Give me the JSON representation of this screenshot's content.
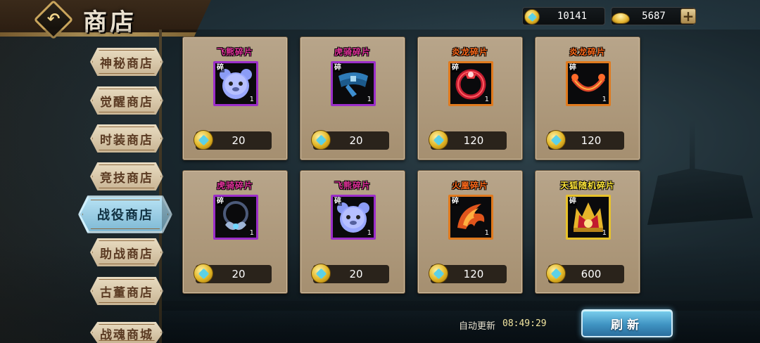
{
  "header": {
    "title": "商店",
    "back_icon": "back-arrow-icon"
  },
  "currency": {
    "gems": {
      "icon": "diamond-coin-icon",
      "value": "10141"
    },
    "gold": {
      "icon": "gold-ingot-icon",
      "value": "5687",
      "add_label": "+"
    }
  },
  "sidebar": {
    "items": [
      {
        "label": "神秘商店",
        "active": false
      },
      {
        "label": "觉醒商店",
        "active": false
      },
      {
        "label": "时装商店",
        "active": false
      },
      {
        "label": "竞技商店",
        "active": false
      },
      {
        "label": "战役商店",
        "active": true
      },
      {
        "label": "助战商店",
        "active": false
      },
      {
        "label": "古董商店",
        "active": false
      },
      {
        "label": "战魂商城",
        "active": false
      }
    ]
  },
  "shop": {
    "fragment_tag": "碎",
    "items": [
      {
        "name": "飞熊碎片",
        "name_color": "#e0329a",
        "qty": "1",
        "price": "20",
        "icon": "flying-bear-icon",
        "quality": "purple"
      },
      {
        "name": "虎骑碎片",
        "name_color": "#e0329a",
        "qty": "1",
        "price": "20",
        "icon": "blue-belt-icon",
        "quality": "purple"
      },
      {
        "name": "炎龙碎片",
        "name_color": "#ff6a1a",
        "qty": "1",
        "price": "120",
        "icon": "red-ring-icon",
        "quality": "orange"
      },
      {
        "name": "炎龙碎片",
        "name_color": "#ff6a1a",
        "qty": "1",
        "price": "120",
        "icon": "dragon-collar-icon",
        "quality": "orange"
      },
      {
        "name": "虎骑碎片",
        "name_color": "#e0329a",
        "qty": "1",
        "price": "20",
        "icon": "winged-necklace-icon",
        "quality": "purple"
      },
      {
        "name": "飞熊碎片",
        "name_color": "#e0329a",
        "qty": "1",
        "price": "20",
        "icon": "flying-bear-icon",
        "quality": "purple"
      },
      {
        "name": "火凰碎片",
        "name_color": "#ff6a1a",
        "qty": "1",
        "price": "120",
        "icon": "fire-phoenix-icon",
        "quality": "orange"
      },
      {
        "name": "天狐随机碎片",
        "name_color": "#ffe63a",
        "qty": "1",
        "price": "600",
        "icon": "sky-fox-crown-icon",
        "quality": "gold"
      }
    ]
  },
  "footer": {
    "auto_refresh_label": "自动更新",
    "auto_refresh_time": "08:49:29",
    "refresh_button": "刷新"
  }
}
